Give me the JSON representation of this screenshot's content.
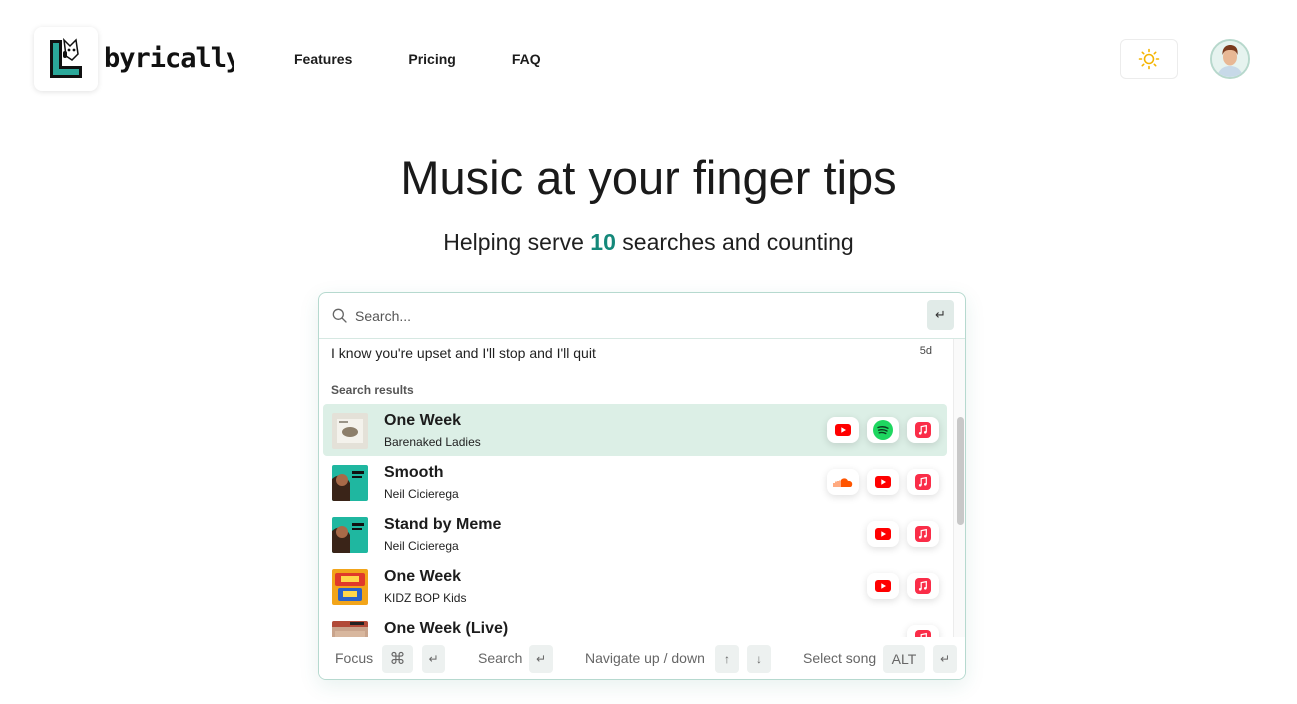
{
  "brand": {
    "name": "Lyrically",
    "wordmark": "byrically"
  },
  "nav": {
    "features": "Features",
    "pricing": "Pricing",
    "faq": "FAQ"
  },
  "hero": {
    "title": "Music at your finger tips",
    "sub_prefix": "Helping serve",
    "sub_count": "10",
    "sub_suffix": "searches and counting"
  },
  "search": {
    "placeholder": "Search...",
    "enter_key": "↵"
  },
  "recent": {
    "query": "I know you're upset and I'll stop and I'll quit",
    "time": "5d"
  },
  "results_label": "Search results",
  "results": [
    {
      "title": "One Week",
      "artist": "Barenaked Ladies",
      "services": [
        "youtube",
        "spotify",
        "apple-music"
      ]
    },
    {
      "title": "Smooth",
      "artist": "Neil Cicierega",
      "services": [
        "soundcloud",
        "youtube",
        "apple-music"
      ]
    },
    {
      "title": "Stand by Meme",
      "artist": "Neil Cicierega",
      "services": [
        "youtube",
        "apple-music"
      ]
    },
    {
      "title": "One Week",
      "artist": "KIDZ BOP Kids",
      "services": [
        "youtube",
        "apple-music"
      ]
    },
    {
      "title": "One Week (Live)",
      "artist": "",
      "services": [
        "apple-music"
      ]
    }
  ],
  "footer": {
    "focus": "Focus",
    "focus_key1": "⌘",
    "focus_key2": "↵",
    "search": "Search",
    "search_key": "↵",
    "navigate": "Navigate up / down",
    "nav_up": "↑",
    "nav_down": "↓",
    "select": "Select song",
    "select_key1": "ALT",
    "select_key2": "↵"
  },
  "colors": {
    "accent": "#14887a",
    "active_row": "#dcefe6",
    "youtube": "#ff0000",
    "spotify": "#1ed760",
    "apple_music": "#fa2d48",
    "soundcloud": "#ff5500"
  }
}
